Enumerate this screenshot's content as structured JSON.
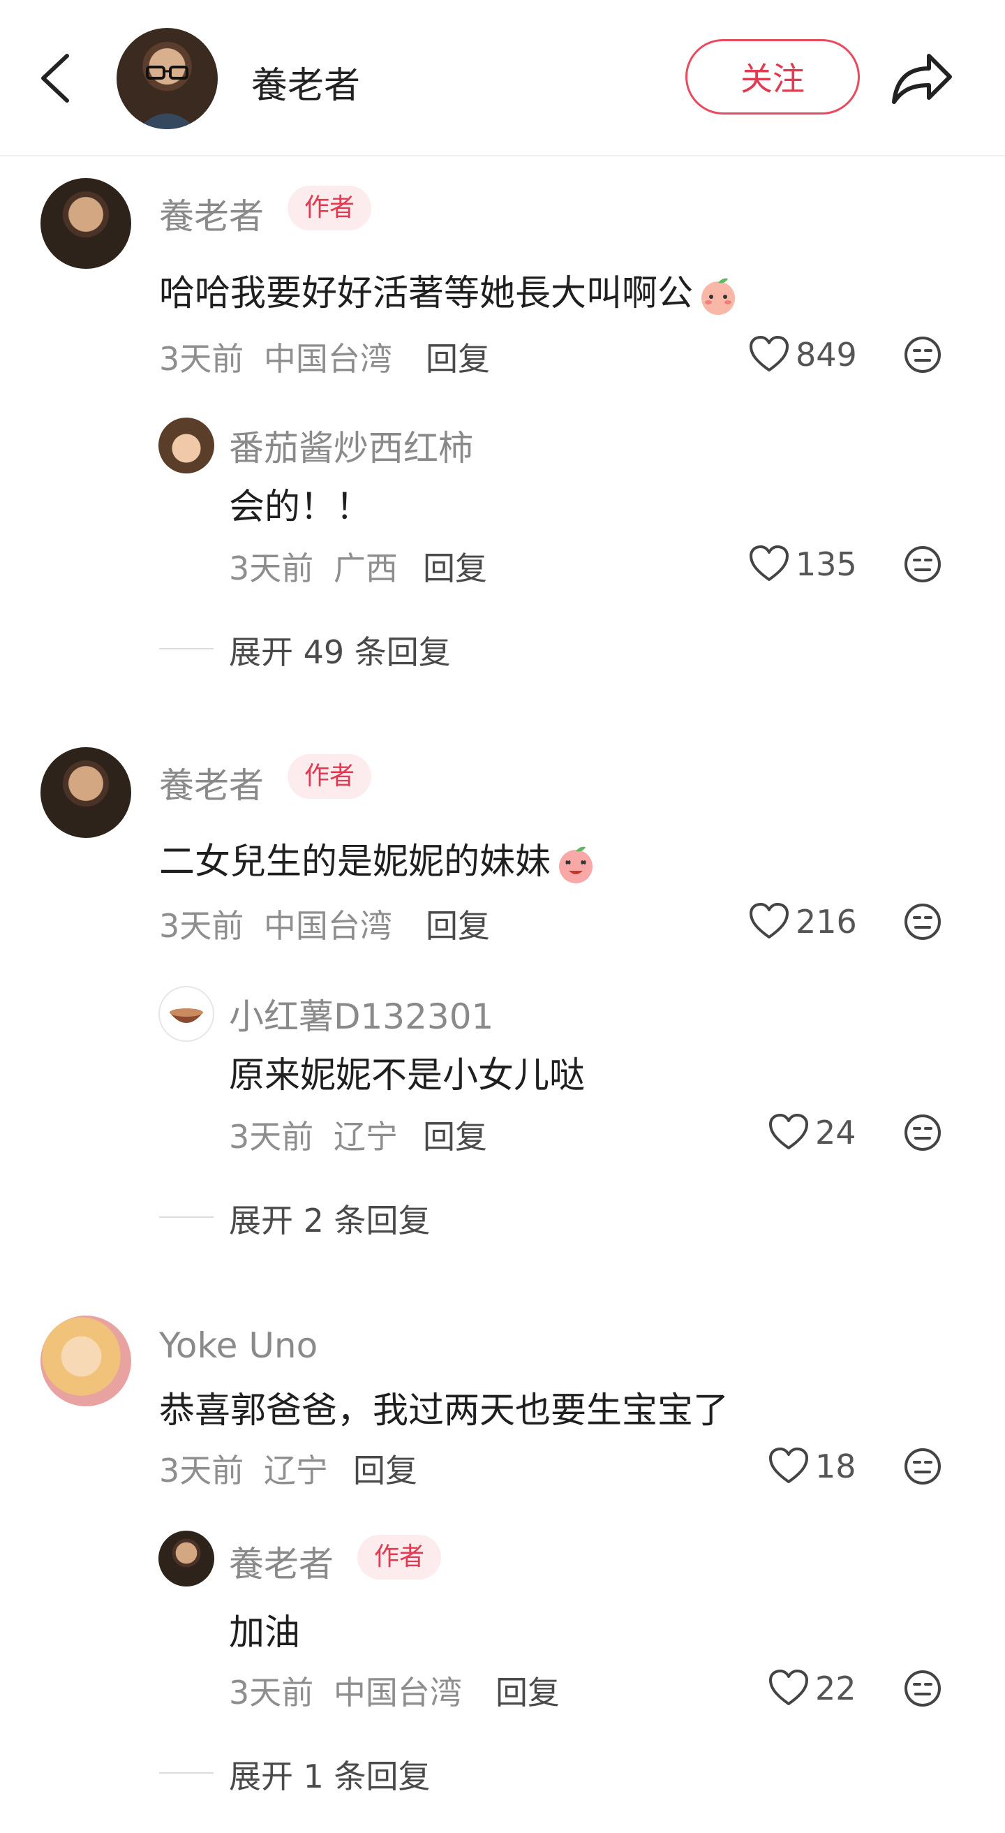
{
  "header": {
    "name": "養老者",
    "follow_label": "关注",
    "icons": {
      "back": "chevron-left-icon",
      "share": "share-arrow-icon"
    }
  },
  "threads": [
    {
      "comment": {
        "author": "養老者",
        "badge": "作者",
        "text": "哈哈我要好好活著等她長大叫啊公",
        "emoji": "peach-blush-emoji",
        "time": "3天前",
        "location": "中国台湾",
        "reply_label": "回复",
        "likes": "849"
      },
      "reply": {
        "author": "番茄酱炒西红柿",
        "text": "会的！！",
        "time": "3天前",
        "location": "广西",
        "reply_label": "回复",
        "likes": "135"
      },
      "expand_label": "展开 49 条回复"
    },
    {
      "comment": {
        "author": "養老者",
        "badge": "作者",
        "text": "二女兒生的是妮妮的妹妹",
        "emoji": "peach-laugh-emoji",
        "time": "3天前",
        "location": "中国台湾",
        "reply_label": "回复",
        "likes": "216"
      },
      "reply": {
        "author": "小红薯D132301",
        "text": "原来妮妮不是小女儿哒",
        "time": "3天前",
        "location": "辽宁",
        "reply_label": "回复",
        "likes": "24"
      },
      "expand_label": "展开 2 条回复"
    },
    {
      "comment": {
        "author": "Yoke Uno",
        "text": "恭喜郭爸爸，我过两天也要生宝宝了",
        "time": "3天前",
        "location": "辽宁",
        "reply_label": "回复",
        "likes": "18"
      },
      "reply": {
        "author": "養老者",
        "badge": "作者",
        "text": "加油",
        "time": "3天前",
        "location": "中国台湾",
        "reply_label": "回复",
        "likes": "22"
      },
      "expand_label": "展开 1 条回复"
    }
  ],
  "colors": {
    "accent": "#e23a50",
    "badge_bg": "#fdecee",
    "muted": "#8e8e8e"
  }
}
